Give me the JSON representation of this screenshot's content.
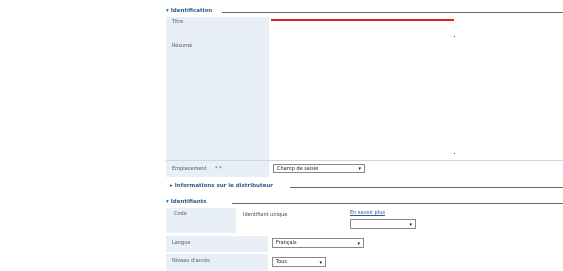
{
  "section1": {
    "legend": "Identification",
    "fields": {
      "title_label": "Titre",
      "summary_label": "Résumé",
      "location_label": "Emplacement",
      "location_value": "Champ de saisie"
    }
  },
  "section2": {
    "legend": "Informations sur le distributeur"
  },
  "section3": {
    "legend": "Identifiants",
    "fields": {
      "code_label": "Code",
      "code_value": "Identifiant unique",
      "code_link": "En savoir plus",
      "code_select": "",
      "language_label": "Langue",
      "language_value": "Français",
      "restriction_label": "Niveau d'accès",
      "restriction_value": "Tous"
    }
  },
  "icons": {
    "collapse": "triangle-down-icon",
    "expand": "triangle-right-icon",
    "dropdown": "chevron-down-icon"
  },
  "colors": {
    "accent": "#2a5a8c",
    "label_bg": "#e8eff7",
    "error_line": "#e02020"
  }
}
